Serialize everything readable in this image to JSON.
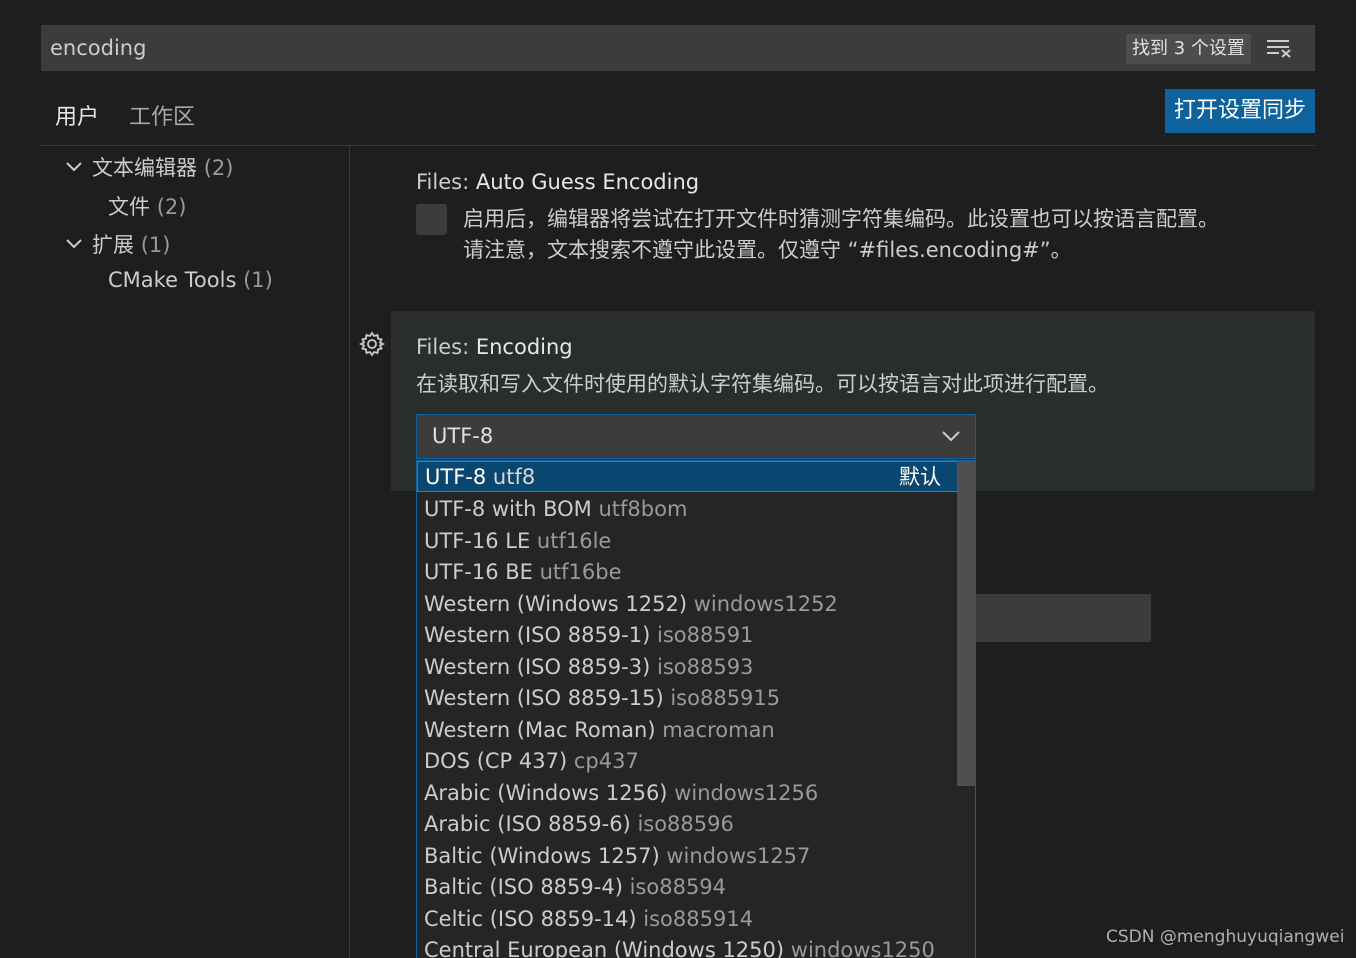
{
  "search": {
    "value": "encoding",
    "result_count": "找到 3 个设置"
  },
  "tabs": [
    {
      "label": "用户",
      "active": true
    },
    {
      "label": "工作区",
      "active": false
    }
  ],
  "sync_button": "打开设置同步",
  "toc": [
    {
      "label": "文本编辑器",
      "count": "(2)",
      "expanded": true,
      "level": 0
    },
    {
      "label": "文件",
      "count": "(2)",
      "level": 1
    },
    {
      "label": "扩展",
      "count": "(1)",
      "expanded": true,
      "level": 0
    },
    {
      "label": "CMake Tools",
      "count": "(1)",
      "level": 1
    }
  ],
  "settings": {
    "auto_guess": {
      "category": "Files: ",
      "name": "Auto Guess Encoding",
      "desc_line1": "启用后，编辑器将尝试在打开文件时猜测字符集编码。此设置也可以按语言配置。",
      "desc_line2": "请注意，文本搜索不遵守此设置。仅遵守 “#files.encoding#”。",
      "checked": false
    },
    "encoding": {
      "category": "Files: ",
      "name": "Encoding",
      "desc": "在读取和写入文件时使用的默认字符集编码。可以按语言对此项进行配置。",
      "selected": "UTF-8"
    }
  },
  "dropdown": {
    "default_label": "默认",
    "options": [
      {
        "label": "UTF-8",
        "value": "utf8"
      },
      {
        "label": "UTF-8 with BOM",
        "value": "utf8bom"
      },
      {
        "label": "UTF-16 LE",
        "value": "utf16le"
      },
      {
        "label": "UTF-16 BE",
        "value": "utf16be"
      },
      {
        "label": "Western (Windows 1252)",
        "value": "windows1252"
      },
      {
        "label": "Western (ISO 8859-1)",
        "value": "iso88591"
      },
      {
        "label": "Western (ISO 8859-3)",
        "value": "iso88593"
      },
      {
        "label": "Western (ISO 8859-15)",
        "value": "iso885915"
      },
      {
        "label": "Western (Mac Roman)",
        "value": "macroman"
      },
      {
        "label": "DOS (CP 437)",
        "value": "cp437"
      },
      {
        "label": "Arabic (Windows 1256)",
        "value": "windows1256"
      },
      {
        "label": "Arabic (ISO 8859-6)",
        "value": "iso88596"
      },
      {
        "label": "Baltic (Windows 1257)",
        "value": "windows1257"
      },
      {
        "label": "Baltic (ISO 8859-4)",
        "value": "iso88594"
      },
      {
        "label": "Celtic (ISO 8859-14)",
        "value": "iso885914"
      },
      {
        "label": "Central European (Windows 1250)",
        "value": "windows1250"
      }
    ]
  },
  "watermark": "CSDN @menghuyuqiangwei",
  "colors": {
    "accent": "#0e639c",
    "selected_option": "#094771",
    "background": "#1e1e1e"
  },
  "icons": [
    "filter-icon",
    "chevron-down-icon",
    "gear-icon"
  ]
}
